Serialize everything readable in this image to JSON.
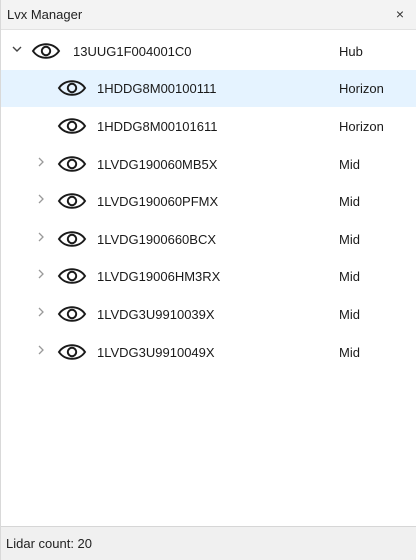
{
  "window": {
    "title": "Lvx Manager",
    "close_glyph": "×"
  },
  "tree": {
    "root": {
      "name": "13UUG1F004001C0",
      "type": "Hub",
      "expanded": true,
      "icon": "eye-icon"
    },
    "children": [
      {
        "name": "1HDDG8M00100111",
        "type": "Horizon",
        "has_children": false,
        "selected": true,
        "icon": "eye-icon"
      },
      {
        "name": "1HDDG8M00101611",
        "type": "Horizon",
        "has_children": false,
        "selected": false,
        "icon": "eye-icon"
      },
      {
        "name": "1LVDG190060MB5X",
        "type": "Mid",
        "has_children": true,
        "selected": false,
        "icon": "eye-icon"
      },
      {
        "name": "1LVDG190060PFMX",
        "type": "Mid",
        "has_children": true,
        "selected": false,
        "icon": "eye-icon"
      },
      {
        "name": "1LVDG1900660BCX",
        "type": "Mid",
        "has_children": true,
        "selected": false,
        "icon": "eye-icon"
      },
      {
        "name": "1LVDG19006HM3RX",
        "type": "Mid",
        "has_children": true,
        "selected": false,
        "icon": "eye-icon"
      },
      {
        "name": "1LVDG3U9910039X",
        "type": "Mid",
        "has_children": true,
        "selected": false,
        "icon": "eye-icon"
      },
      {
        "name": "1LVDG3U9910049X",
        "type": "Mid",
        "has_children": true,
        "selected": false,
        "icon": "eye-icon"
      }
    ]
  },
  "status": {
    "text": "Lidar count: 20"
  },
  "colors": {
    "selection": "#e5f3ff",
    "titlebar": "#f3f3f3",
    "statusbar": "#f0f0f0"
  }
}
